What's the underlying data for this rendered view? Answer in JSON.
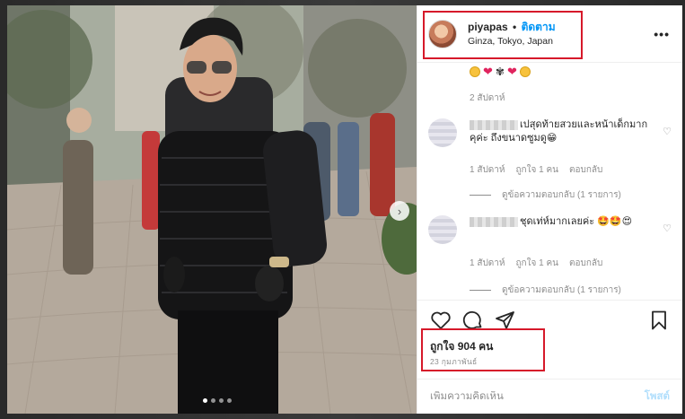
{
  "header": {
    "username": "piyapas",
    "separator": "•",
    "follow_label": "ติดตาม",
    "location": "Ginza, Tokyo, Japan",
    "more_icon": "more-horizontal-icon",
    "more_glyph": "•••"
  },
  "caption_reply": {
    "emojis": [
      "smiling-face",
      "red-heart",
      "flower",
      "red-heart",
      "smiling-face"
    ],
    "time": "2 สัปดาห์"
  },
  "comments": [
    {
      "username_blurred": true,
      "text": "เปสุดท้ายสวยและหน้าเด็กมากคุค่ะ ถึงขนาดซูมดู😁",
      "time": "1 สัปดาห์",
      "likes": "ถูกใจ 1 คน",
      "reply_label": "ตอบกลับ",
      "view_replies": "ดูข้อความตอบกลับ (1 รายการ)"
    },
    {
      "username_blurred": true,
      "text": "ชุดเท่ห์มากเลยค่ะ 🤩🤩😍",
      "time": "1 สัปดาห์",
      "likes": "ถูกใจ 1 คน",
      "reply_label": "ตอบกลับ",
      "view_replies": "ดูข้อความตอบกลับ (1 รายการ)"
    }
  ],
  "actions": {
    "like_icon": "heart-icon",
    "comment_icon": "comment-icon",
    "share_icon": "paper-plane-icon",
    "save_icon": "bookmark-icon"
  },
  "likes_text": "ถูกใจ 904 คน",
  "post_date": "23 กุมภาพันธ์",
  "add_comment": {
    "placeholder": "เพิ่มความคิดเห็น",
    "post_label": "โพสต์"
  },
  "carousel": {
    "next_glyph": "›",
    "dots": 4,
    "active_dot": 1
  },
  "colors": {
    "highlight_box": "#d6192a",
    "follow_blue": "#0095f6",
    "post_button_disabled": "#b2dffc"
  }
}
